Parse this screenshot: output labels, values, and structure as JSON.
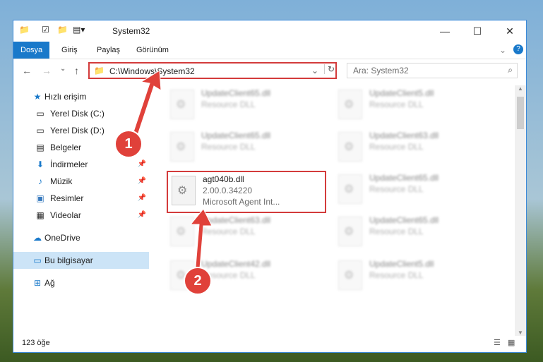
{
  "window": {
    "title": "System32"
  },
  "ribbon_tabs": [
    {
      "label": "Dosya",
      "active": true
    },
    {
      "label": "Giriş",
      "active": false
    },
    {
      "label": "Paylaş",
      "active": false
    },
    {
      "label": "Görünüm",
      "active": false
    }
  ],
  "address": {
    "path": "C:\\Windows\\System32"
  },
  "search": {
    "placeholder": "Ara: System32"
  },
  "nav": [
    {
      "label": "Hızlı erişim",
      "icon": "star-icon"
    },
    {
      "label": "Yerel Disk (C:)",
      "icon": "drive-icon"
    },
    {
      "label": "Yerel Disk (D:)",
      "icon": "drive-icon"
    },
    {
      "label": "Belgeler",
      "icon": "documents-icon",
      "pinned": true
    },
    {
      "label": "İndirmeler",
      "icon": "download-icon",
      "pinned": true
    },
    {
      "label": "Müzik",
      "icon": "music-icon",
      "pinned": true
    },
    {
      "label": "Resimler",
      "icon": "pictures-icon",
      "pinned": true
    },
    {
      "label": "Videolar",
      "icon": "videos-icon",
      "pinned": true
    },
    {
      "label": "OneDrive",
      "icon": "cloud-icon"
    },
    {
      "label": "Bu bilgisayar",
      "icon": "computer-icon",
      "selected": true
    },
    {
      "label": "Ağ",
      "icon": "network-icon"
    }
  ],
  "files": [
    {
      "name": "UpdateClient65.dll",
      "type": "Resource DLL"
    },
    {
      "name": "UpdateClient5.dll",
      "type": "Resource DLL"
    },
    {
      "name": "UpdateClient65.dll",
      "type": "Resource DLL"
    },
    {
      "name": "UpdateClient63.dll",
      "type": "Resource DLL"
    },
    {
      "name": "agt040b.dll",
      "version": "2.00.0.34220",
      "desc": "Microsoft Agent Int..."
    },
    {
      "name": "UpdateClient65.dll",
      "type": "Resource DLL"
    },
    {
      "name": "UpdateClient63.dll",
      "type": "Resource DLL"
    },
    {
      "name": "UpdateClient65.dll",
      "type": "Resource DLL"
    },
    {
      "name": "UpdateClient42.dll",
      "type": "Resource DLL"
    },
    {
      "name": "UpdateClient5.dll",
      "type": "Resource DLL"
    }
  ],
  "status": {
    "count": "123 öğe"
  },
  "badges": [
    "1",
    "2"
  ],
  "colors": {
    "accent": "#1979ca",
    "annotation": "#e0413a"
  }
}
